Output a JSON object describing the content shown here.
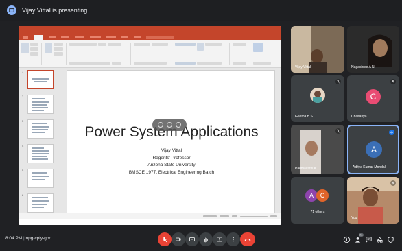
{
  "presenting": {
    "text": "Vijay Vittal is presenting"
  },
  "slide": {
    "title": "Power System Applications",
    "lines": [
      "Vijay Vittal",
      "Regents’ Professor",
      "Arizona State University",
      "BMSCE 1977, Electrical Engineering Batch"
    ]
  },
  "participants": [
    {
      "name": "Vijay Vittal"
    },
    {
      "name": "Nagashree A N"
    },
    {
      "name": "Geetha B S"
    },
    {
      "name": "Chaitanya L",
      "initial": "C",
      "color": "#e94c73"
    },
    {
      "name": "Padmavathi K"
    },
    {
      "name": "Aditya Kumar Mondal",
      "initial": "A",
      "color": "#3b6fb6"
    },
    {
      "name": "71 others",
      "initials": [
        "A",
        "C"
      ],
      "colors": [
        "#8e44ad",
        "#e0642a"
      ]
    },
    {
      "name": "You"
    }
  ],
  "bottom_bar": {
    "time": "8:04 PM",
    "meeting_code": "npg-cply-gbq",
    "people_count": "79"
  },
  "colors": {
    "accent": "#8ab4f8",
    "danger": "#ea4335",
    "ppt": "#c4452b"
  }
}
